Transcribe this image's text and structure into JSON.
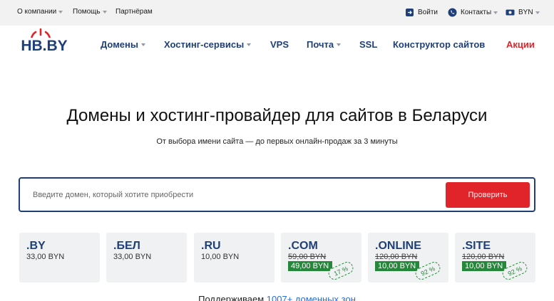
{
  "topbar": {
    "company": "О компании",
    "help": "Помощь",
    "partners": "Партнёрам",
    "login": "Войти",
    "contacts": "Контакты",
    "currency": "BYN"
  },
  "logo": {
    "text": "HB.BY"
  },
  "nav": {
    "domains": "Домены",
    "hosting": "Хостинг-сервисы",
    "vps": "VPS",
    "mail": "Почта",
    "ssl": "SSL",
    "builder": "Конструктор сайтов",
    "promo": "Акции"
  },
  "hero": {
    "title": "Домены и хостинг-провайдер для сайтов в Беларуси",
    "subtitle": "От выбора имени сайта — до первых онлайн-продаж за 3 минуты"
  },
  "search": {
    "placeholder": "Введите домен, который хотите приобрести",
    "button": "Проверить"
  },
  "zones": [
    {
      "name": ".BY",
      "price": "33,00 BYN"
    },
    {
      "name": ".БЕЛ",
      "price": "33,00 BYN"
    },
    {
      "name": ".RU",
      "price": "10,00 BYN"
    },
    {
      "name": ".COM",
      "old_price": "59,00 BYN",
      "new_price": "49,00 BYN",
      "discount": "17 %"
    },
    {
      "name": ".ONLINE",
      "old_price": "120,00 BYN",
      "new_price": "10,00 BYN",
      "discount": "92 %"
    },
    {
      "name": ".SITE",
      "old_price": "120,00 BYN",
      "new_price": "10,00 BYN",
      "discount": "92 %"
    }
  ],
  "support": {
    "text": "Поддерживаем ",
    "link": "1007+ доменных зон"
  },
  "colors": {
    "brand_blue": "#1f3f79",
    "accent_red": "#e0242a",
    "discount_green": "#24873a",
    "link_blue": "#2a6dd6"
  },
  "icons": {
    "login": "login-icon",
    "contacts": "phone-icon",
    "currency": "currency-icon"
  }
}
